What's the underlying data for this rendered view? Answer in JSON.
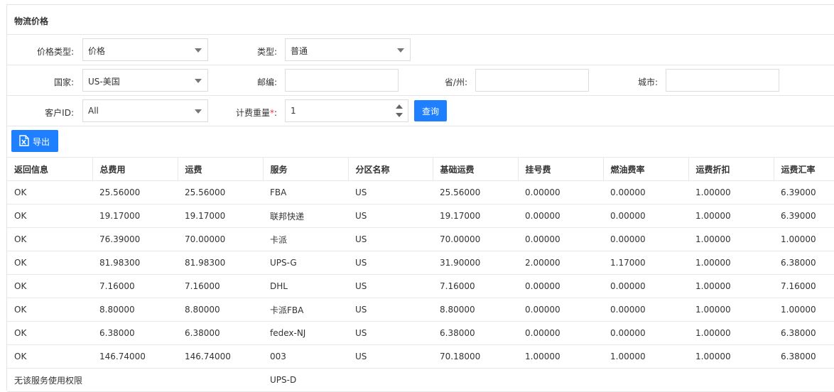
{
  "panel": {
    "title": "物流价格"
  },
  "form": {
    "price_type": {
      "label": "价格类型:",
      "value": "价格"
    },
    "type": {
      "label": "类型:",
      "value": "普通"
    },
    "country": {
      "label": "国家:",
      "value": "US-美国"
    },
    "zip": {
      "label": "邮编:",
      "value": ""
    },
    "province": {
      "label": "省/州:",
      "value": ""
    },
    "city": {
      "label": "城市:",
      "value": ""
    },
    "customer": {
      "label": "客户ID:",
      "value": "All"
    },
    "weight": {
      "label": "计费重量",
      "required": "*",
      "colon": ":",
      "value": "1"
    },
    "query_label": "查询"
  },
  "toolbar": {
    "export_label": "导出"
  },
  "table": {
    "columns": [
      "返回信息",
      "总费用",
      "运费",
      "服务",
      "分区名称",
      "基础运费",
      "挂号费",
      "燃油费率",
      "运费折扣",
      "运费汇率"
    ],
    "rows": [
      [
        "OK",
        "25.56000",
        "25.56000",
        "FBA",
        "US",
        "25.56000",
        "0.00000",
        "0.00000",
        "1.00000",
        "6.39000"
      ],
      [
        "OK",
        "19.17000",
        "19.17000",
        "联邦快递",
        "US",
        "19.17000",
        "0.00000",
        "0.00000",
        "1.00000",
        "6.39000"
      ],
      [
        "OK",
        "76.39000",
        "70.00000",
        "卡派",
        "US",
        "70.00000",
        "0.00000",
        "0.00000",
        "1.00000",
        "1.00000"
      ],
      [
        "OK",
        "81.98300",
        "81.98300",
        "UPS-G",
        "US",
        "31.90000",
        "2.00000",
        "1.17000",
        "1.00000",
        "6.38000"
      ],
      [
        "OK",
        "7.16000",
        "7.16000",
        "DHL",
        "US",
        "7.16000",
        "0.00000",
        "0.00000",
        "1.00000",
        "7.16000"
      ],
      [
        "OK",
        "8.80000",
        "8.80000",
        "卡派FBA",
        "US",
        "8.80000",
        "0.00000",
        "0.00000",
        "1.00000",
        "1.00000"
      ],
      [
        "OK",
        "6.38000",
        "6.38000",
        "fedex-NJ",
        "US",
        "6.38000",
        "0.00000",
        "0.00000",
        "1.00000",
        "6.38000"
      ],
      [
        "OK",
        "146.74000",
        "146.74000",
        "003",
        "US",
        "70.18000",
        "1.00000",
        "1.00000",
        "1.00000",
        "6.38000"
      ],
      [
        "无该服务使用权限",
        "",
        "",
        "UPS-D",
        "",
        "",
        "",
        "",
        "",
        ""
      ]
    ]
  }
}
